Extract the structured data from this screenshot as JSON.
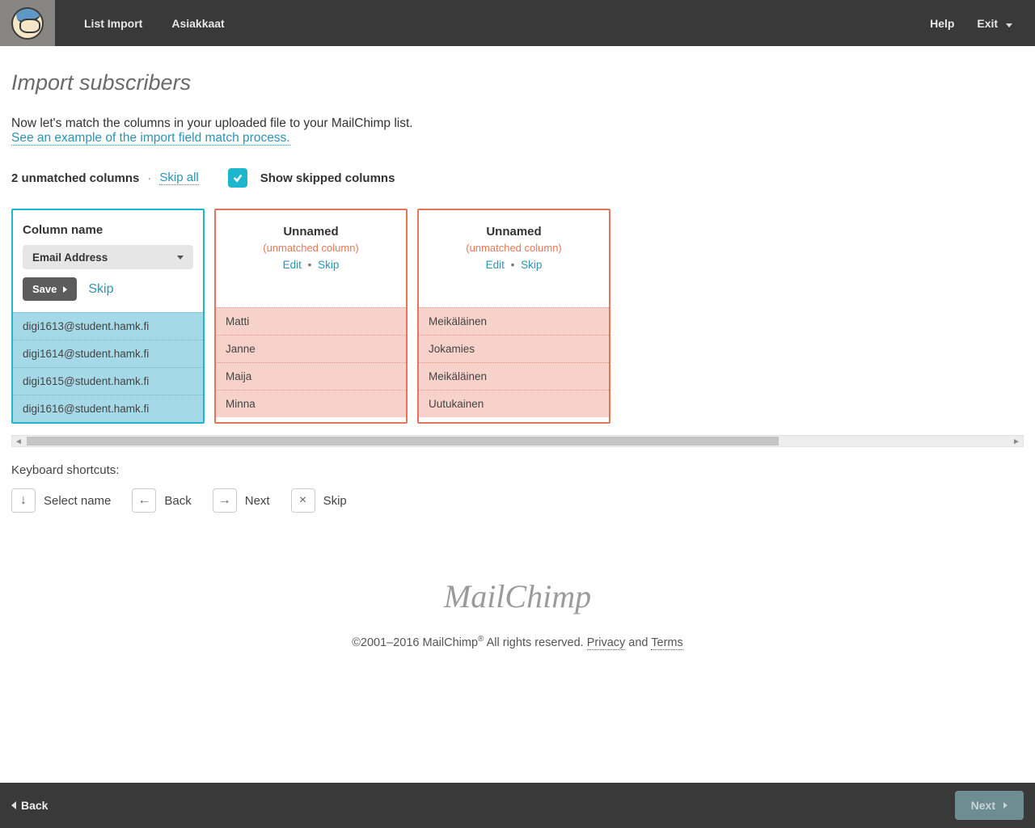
{
  "nav": {
    "left": [
      "List Import",
      "Asiakkaat"
    ],
    "help": "Help",
    "exit": "Exit"
  },
  "page": {
    "title": "Import subscribers",
    "intro": "Now let's match the columns in your uploaded file to your MailChimp list.",
    "example_link": "See an example of the import field match process."
  },
  "unmatched": {
    "count_text": "2 unmatched columns",
    "skip_all": "Skip all",
    "show_skipped_checked": true,
    "show_skipped_label": "Show skipped columns"
  },
  "matched_column": {
    "header_label": "Column name",
    "selected_field": "Email Address",
    "save_label": "Save",
    "skip_label": "Skip",
    "rows": [
      "digi1613@student.hamk.fi",
      "digi1614@student.hamk.fi",
      "digi1615@student.hamk.fi",
      "digi1616@student.hamk.fi"
    ]
  },
  "unmatched_columns": [
    {
      "title": "Unnamed",
      "subtitle": "(unmatched column)",
      "edit": "Edit",
      "skip": "Skip",
      "rows": [
        "Matti",
        "Janne",
        "Maija",
        "Minna"
      ]
    },
    {
      "title": "Unnamed",
      "subtitle": "(unmatched column)",
      "edit": "Edit",
      "skip": "Skip",
      "rows": [
        "Meikäläinen",
        "Jokamies",
        "Meikäläinen",
        "Uutukainen"
      ]
    }
  ],
  "shortcuts": {
    "title": "Keyboard shortcuts:",
    "items": [
      {
        "key": "↓",
        "label": "Select name"
      },
      {
        "key": "←",
        "label": "Back"
      },
      {
        "key": "→",
        "label": "Next"
      },
      {
        "key": "×",
        "label": "Skip"
      }
    ]
  },
  "footer": {
    "brand": "MailChimp",
    "copyright_prefix": "©2001–2016 MailChimp",
    "copyright_suffix": " All rights reserved. ",
    "privacy": "Privacy",
    "and": " and ",
    "terms": "Terms"
  },
  "bottombar": {
    "back": "Back",
    "next": "Next"
  }
}
